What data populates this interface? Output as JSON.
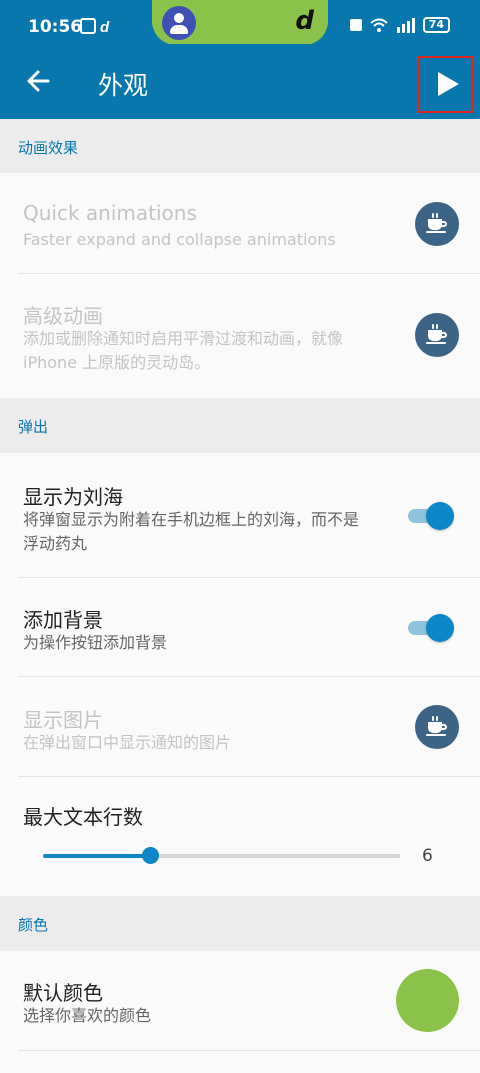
{
  "status_bar": {
    "time": "10:56",
    "left_icons": "HD d",
    "right_icons": "HD 5G",
    "battery": "74"
  },
  "toolbar": {
    "title": "外观",
    "back_icon": "arrow-left-icon",
    "play_icon": "play-icon"
  },
  "sections": {
    "animation": {
      "header": "动画效果",
      "items": [
        {
          "title": "Quick animations",
          "subtitle": "Faster expand and collapse animations",
          "control": "coffee-icon",
          "enabled": false
        },
        {
          "title": "高级动画",
          "subtitle": "添加或删除通知时启用平滑过渡和动画，就像 iPhone 上原版的灵动岛。",
          "control": "coffee-icon",
          "enabled": false
        }
      ]
    },
    "popup": {
      "header": "弹出",
      "items": [
        {
          "title": "显示为刘海",
          "subtitle": "将弹窗显示为附着在手机边框上的刘海，而不是浮动药丸",
          "control": "switch",
          "checked": true
        },
        {
          "title": "添加背景",
          "subtitle": "为操作按钮添加背景",
          "control": "switch",
          "checked": true
        },
        {
          "title": "显示图片",
          "subtitle": "在弹出窗口中显示通知的图片",
          "control": "coffee-icon",
          "enabled": false
        },
        {
          "title": "最大文本行数",
          "control": "slider",
          "value": "6",
          "fraction": 0.3
        }
      ]
    },
    "color": {
      "header": "颜色",
      "items": [
        {
          "title": "默认颜色",
          "subtitle": "选择你喜欢的颜色",
          "swatch_color": "#8bc34a"
        }
      ]
    }
  },
  "colors": {
    "primary": "#0777ad",
    "accent": "#0c87c8",
    "coffee_badge": "#3c6486",
    "highlight_box": "#e0241e"
  }
}
